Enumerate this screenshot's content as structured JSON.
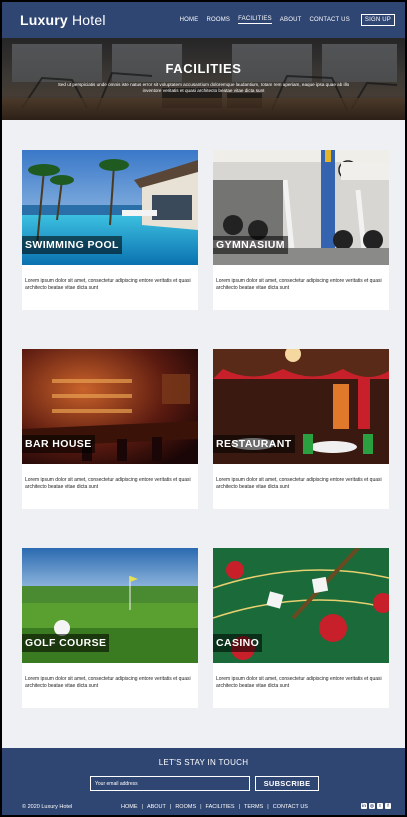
{
  "header": {
    "logo_bold": "Luxury",
    "logo_light": " Hotel",
    "nav": [
      {
        "label": "HOME"
      },
      {
        "label": "ROOMS"
      },
      {
        "label": "FACILITIES",
        "active": true
      },
      {
        "label": "ABOUT"
      },
      {
        "label": "CONTACT US"
      }
    ],
    "signup": "SIGN UP"
  },
  "hero": {
    "title": "FACILITIES",
    "subtitle": "Sed ut perspiciatis unde omnis iste natus error sit voluptatem accusantium doloremque laudantium, totam rem aperiam, eaque ipsa quae ab illo inventore veritatis et quasi architecto  beatae vitae dicta sunt"
  },
  "facilities": [
    {
      "title": "SWIMMING POOL",
      "text": "Lorem ipsum dolor sit amet, consectetur adipiscing entore veritatis et quasi architecto  beatae vitae dicta sunt"
    },
    {
      "title": "GYMNASIUM",
      "text": "Lorem ipsum dolor sit amet, consectetur adipiscing entore veritatis et quasi architecto  beatae vitae dicta sunt"
    },
    {
      "title": "BAR HOUSE",
      "text": "Lorem ipsum dolor sit amet, consectetur adipiscing entore veritatis et quasi architecto  beatae vitae dicta sunt"
    },
    {
      "title": "RESTAURANT",
      "text": "Lorem ipsum dolor sit amet, consectetur adipiscing entore veritatis et quasi architecto  beatae vitae dicta sunt"
    },
    {
      "title": "GOLF COURSE",
      "text": "Lorem ipsum dolor sit amet, consectetur adipiscing entore veritatis et quasi architecto  beatae vitae dicta sunt"
    },
    {
      "title": "CASINO",
      "text": "Lorem ipsum dolor sit amet, consectetur adipiscing entore veritatis et quasi architecto  beatae vitae dicta sunt"
    }
  ],
  "footer": {
    "heading": "LET'S STAY IN TOUCH",
    "email_placeholder": "Your email address",
    "subscribe": "SUBSCRIBE",
    "copyright": "© 2020 Luxury Hotel",
    "links": [
      {
        "label": "HOME"
      },
      {
        "label": "ABOUT"
      },
      {
        "label": "ROOMS"
      },
      {
        "label": "FACILITIES"
      },
      {
        "label": "TERMS"
      },
      {
        "label": "CONTACT US"
      }
    ],
    "social_icons": [
      "linkedin-icon",
      "instagram-icon",
      "twitter-icon",
      "facebook-icon"
    ]
  },
  "colors": {
    "primary": "#2f4572",
    "background": "#eef0f4"
  }
}
